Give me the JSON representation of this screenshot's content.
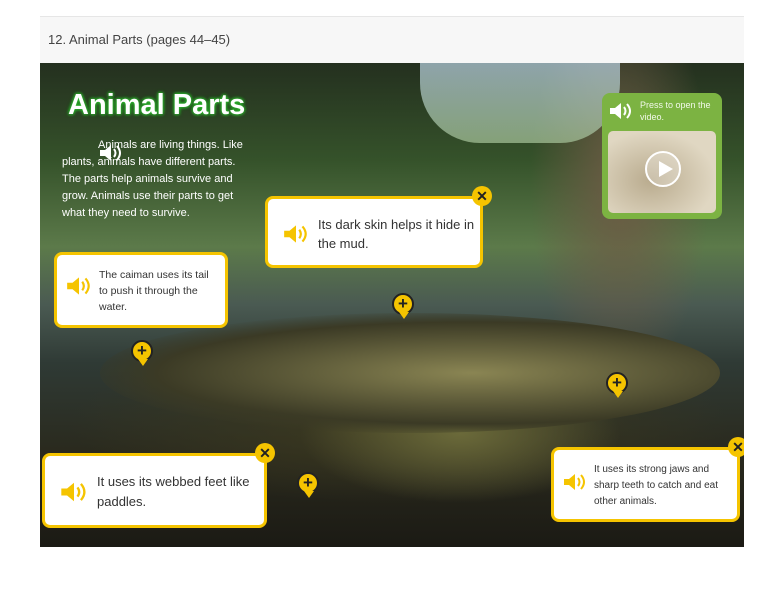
{
  "header": {
    "title": "12. Animal Parts (pages 44–45)"
  },
  "page": {
    "title": "Animal Parts",
    "intro": "Animals are living things. Like plants, animals have different parts. The parts help animals survive and grow. Animals use their parts to get what they need to survive.",
    "video": {
      "label": "Press to open the video.",
      "icon": "play-icon"
    },
    "callouts": [
      {
        "text": "Its dark skin helps it hide in the mud."
      },
      {
        "text": "The caiman uses its tail to push it through the water."
      },
      {
        "text": "It uses its webbed feet like paddles."
      },
      {
        "text": "It uses its strong jaws and sharp teeth to catch and eat other animals."
      }
    ],
    "close_label": "✕",
    "hotspot_label": "+"
  },
  "colors": {
    "accent": "#f5c400",
    "video_bg": "#7cb342",
    "title_glow": "#2db82d"
  }
}
